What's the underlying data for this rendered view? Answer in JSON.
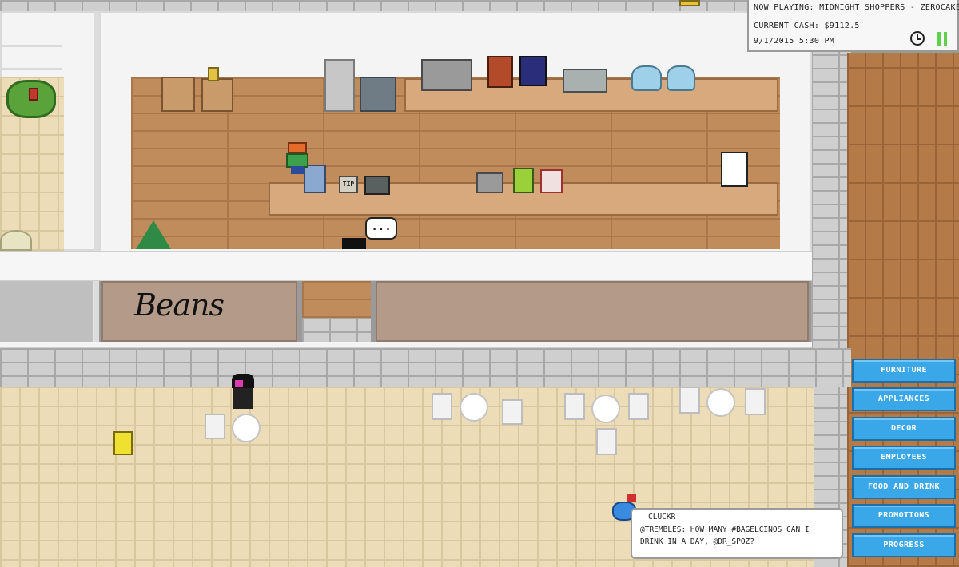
{
  "hud": {
    "now_playing": "Now Playing: Midnight Shoppers - Zerocakes",
    "current_cash": "Current Cash: $9112.5",
    "datetime": "9/1/2015 5:30 PM",
    "clock_icon": "clock-icon",
    "pause_icon": "pause-icon"
  },
  "shop": {
    "sign": "Beans",
    "tip_jar_label": "TIP",
    "npc_speech": "..."
  },
  "menu": {
    "items": [
      {
        "label": "Furniture"
      },
      {
        "label": "Appliances"
      },
      {
        "label": "Decor"
      },
      {
        "label": "Employees"
      },
      {
        "label": "Food and Drink"
      },
      {
        "label": "Promotions"
      },
      {
        "label": "Progress"
      }
    ]
  },
  "chat": {
    "username": "Cluckr",
    "message": "@trembles: how many #bagelcinos can i drink in a day, @dr_spoz?",
    "avatar_icon": "bird-icon"
  },
  "colors": {
    "menu_button": "#3aa7e8",
    "wood_floor": "#c08c5c",
    "tile_floor": "#ecdcb8",
    "brick": "#cfcfcf"
  }
}
